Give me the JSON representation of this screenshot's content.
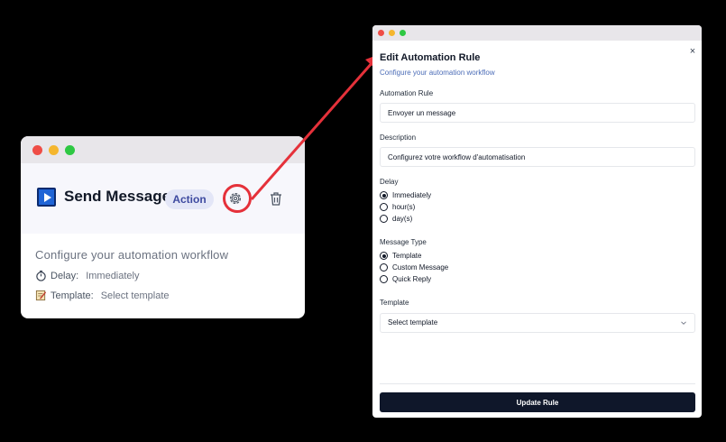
{
  "card": {
    "title": "Send Message",
    "badge": "Action",
    "description": "Configure your automation workflow",
    "delay_label": "Delay:",
    "delay_value": "Immediately",
    "template_label": "Template:",
    "template_value": "Select template",
    "icons": [
      "play-icon",
      "gear-icon",
      "trash-icon",
      "stopwatch-icon",
      "memo-icon"
    ]
  },
  "dialog": {
    "title": "Edit Automation Rule",
    "subtitle": "Configure your automation workflow",
    "rule_label": "Automation Rule",
    "rule_value": "Envoyer un message",
    "description_label": "Description",
    "description_value": "Configurez votre workflow d'automatisation",
    "delay_label": "Delay",
    "delay_options": [
      {
        "label": "Immediately",
        "checked": true
      },
      {
        "label": "hour(s)",
        "checked": false
      },
      {
        "label": "day(s)",
        "checked": false
      }
    ],
    "message_type_label": "Message Type",
    "message_type_options": [
      {
        "label": "Template",
        "checked": true
      },
      {
        "label": "Custom Message",
        "checked": false
      },
      {
        "label": "Quick Reply",
        "checked": false
      }
    ],
    "template_label": "Template",
    "template_placeholder": "Select template",
    "submit_label": "Update Rule",
    "close_glyph": "×"
  },
  "colors": {
    "highlight": "#e5313a",
    "primary": "#0f172a",
    "badge_bg": "#e3e6f7",
    "badge_text": "#3e4aa0",
    "subtitle": "#4b6cb7"
  }
}
